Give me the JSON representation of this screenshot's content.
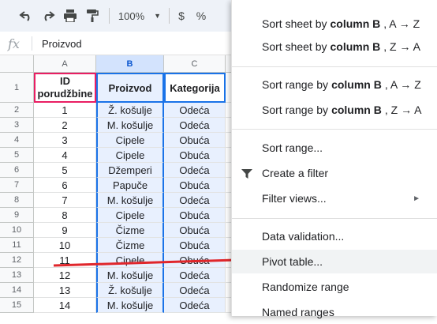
{
  "toolbar": {
    "undo_icon": "undo-icon",
    "redo_icon": "redo-icon",
    "print_icon": "print-icon",
    "paint_format_icon": "paint-format-icon",
    "zoom": "100%",
    "currency": "$",
    "percent": "%"
  },
  "formula": {
    "fx": "fx",
    "value": "Proizvod"
  },
  "columns": [
    "A",
    "B",
    "C"
  ],
  "rows": [
    "1",
    "2",
    "3",
    "4",
    "5",
    "6",
    "7",
    "8",
    "9",
    "10",
    "11",
    "12",
    "13",
    "14",
    "15"
  ],
  "header_row": {
    "a": "ID porudžbine",
    "b": "Proizvod",
    "c": "Kategorija"
  },
  "data_rows": [
    {
      "a": "1",
      "b": "Ž. košulje",
      "c": "Odeća"
    },
    {
      "a": "2",
      "b": "M. košulje",
      "c": "Odeća"
    },
    {
      "a": "3",
      "b": "Cipele",
      "c": "Obuća"
    },
    {
      "a": "4",
      "b": "Cipele",
      "c": "Obuća"
    },
    {
      "a": "5",
      "b": "Džemperi",
      "c": "Odeća"
    },
    {
      "a": "6",
      "b": "Papuče",
      "c": "Obuća"
    },
    {
      "a": "7",
      "b": "M. košulje",
      "c": "Odeća"
    },
    {
      "a": "8",
      "b": "Cipele",
      "c": "Obuća"
    },
    {
      "a": "9",
      "b": "Čizme",
      "c": "Obuća"
    },
    {
      "a": "10",
      "b": "Čizme",
      "c": "Obuća"
    },
    {
      "a": "11",
      "b": "Cipele",
      "c": "Obuća"
    },
    {
      "a": "12",
      "b": "M. košulje",
      "c": "Odeća"
    },
    {
      "a": "13",
      "b": "Ž. košulje",
      "c": "Odeća"
    },
    {
      "a": "14",
      "b": "M. košulje",
      "c": "Odeća"
    }
  ],
  "menu": {
    "sort_sheet_az": {
      "pre": "Sort sheet by",
      "col": "column B",
      "post": ", A → Z"
    },
    "sort_sheet_za": {
      "pre": "Sort sheet by",
      "col": "column B",
      "post": ", Z → A"
    },
    "sort_range_az": {
      "pre": "Sort range by",
      "col": "column B",
      "post": ", A → Z"
    },
    "sort_range_za": {
      "pre": "Sort range by",
      "col": "column B",
      "post": ", Z → A"
    },
    "sort_range": "Sort range...",
    "create_filter": "Create a filter",
    "filter_views": "Filter views...",
    "data_validation": "Data validation...",
    "pivot_table": "Pivot table...",
    "randomize_range": "Randomize range",
    "named_ranges": "Named ranges"
  },
  "colors": {
    "annotation_arrow": "#e0262b",
    "selection": "#1a73e8",
    "pink_border": "#e91e63"
  }
}
